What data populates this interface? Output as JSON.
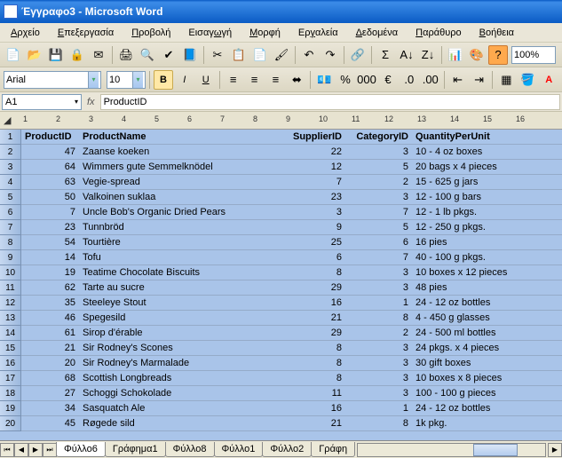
{
  "window": {
    "title": "Έγγραφο3 - Microsoft Word"
  },
  "menu": {
    "items": [
      {
        "label": "Αρχείο",
        "u": 0
      },
      {
        "label": "Επεξεργασία",
        "u": 0
      },
      {
        "label": "Προβολή",
        "u": 0
      },
      {
        "label": "Εισαγωγή",
        "u": 5
      },
      {
        "label": "Μορφή",
        "u": 0
      },
      {
        "label": "Εργαλεία",
        "u": 2
      },
      {
        "label": "Δεδομένα",
        "u": 0
      },
      {
        "label": "Παράθυρο",
        "u": 0
      },
      {
        "label": "Βοήθεια",
        "u": 0
      }
    ]
  },
  "toolbar1": {
    "zoom": "100%"
  },
  "toolbar2": {
    "font": "Arial",
    "size": "10"
  },
  "namebox": {
    "cell": "A1",
    "formula": "ProductID",
    "fx": "fx"
  },
  "ruler": {
    "marks": [
      "1",
      "2",
      "3",
      "4",
      "5",
      "6",
      "7",
      "8",
      "9",
      "10",
      "11",
      "12",
      "13",
      "14",
      "15",
      "16"
    ]
  },
  "columns": [
    "ProductID",
    "ProductName",
    "SupplierID",
    "CategoryID",
    "QuantityPerUnit"
  ],
  "rows": [
    {
      "pid": "47",
      "name": "Zaanse koeken",
      "sid": "22",
      "cid": "3",
      "qpu": "10 - 4 oz boxes"
    },
    {
      "pid": "64",
      "name": "Wimmers gute Semmelknödel",
      "sid": "12",
      "cid": "5",
      "qpu": "20 bags x 4 pieces"
    },
    {
      "pid": "63",
      "name": "Vegie-spread",
      "sid": "7",
      "cid": "2",
      "qpu": "15 - 625 g jars"
    },
    {
      "pid": "50",
      "name": "Valkoinen suklaa",
      "sid": "23",
      "cid": "3",
      "qpu": "12 - 100 g bars"
    },
    {
      "pid": "7",
      "name": "Uncle Bob's Organic Dried Pears",
      "sid": "3",
      "cid": "7",
      "qpu": "12 - 1 lb pkgs."
    },
    {
      "pid": "23",
      "name": "Tunnbröd",
      "sid": "9",
      "cid": "5",
      "qpu": "12 - 250 g pkgs."
    },
    {
      "pid": "54",
      "name": "Tourtière",
      "sid": "25",
      "cid": "6",
      "qpu": "16 pies"
    },
    {
      "pid": "14",
      "name": "Tofu",
      "sid": "6",
      "cid": "7",
      "qpu": "40 - 100 g pkgs."
    },
    {
      "pid": "19",
      "name": "Teatime Chocolate Biscuits",
      "sid": "8",
      "cid": "3",
      "qpu": "10 boxes x 12 pieces"
    },
    {
      "pid": "62",
      "name": "Tarte au sucre",
      "sid": "29",
      "cid": "3",
      "qpu": "48 pies"
    },
    {
      "pid": "35",
      "name": "Steeleye Stout",
      "sid": "16",
      "cid": "1",
      "qpu": "24 - 12 oz bottles"
    },
    {
      "pid": "46",
      "name": "Spegesild",
      "sid": "21",
      "cid": "8",
      "qpu": "4 - 450 g glasses"
    },
    {
      "pid": "61",
      "name": "Sirop d'érable",
      "sid": "29",
      "cid": "2",
      "qpu": "24 - 500 ml bottles"
    },
    {
      "pid": "21",
      "name": "Sir Rodney's Scones",
      "sid": "8",
      "cid": "3",
      "qpu": "24 pkgs. x 4 pieces"
    },
    {
      "pid": "20",
      "name": "Sir Rodney's Marmalade",
      "sid": "8",
      "cid": "3",
      "qpu": "30 gift boxes"
    },
    {
      "pid": "68",
      "name": "Scottish Longbreads",
      "sid": "8",
      "cid": "3",
      "qpu": "10 boxes x 8 pieces"
    },
    {
      "pid": "27",
      "name": "Schoggi Schokolade",
      "sid": "11",
      "cid": "3",
      "qpu": "100 - 100 g pieces"
    },
    {
      "pid": "34",
      "name": "Sasquatch Ale",
      "sid": "16",
      "cid": "1",
      "qpu": "24 - 12 oz bottles"
    },
    {
      "pid": "45",
      "name": "Røgede sild",
      "sid": "21",
      "cid": "8",
      "qpu": "1k pkg."
    }
  ],
  "sheets": {
    "tabs": [
      "Φύλλο6",
      "Γράφημα1",
      "Φύλλο8",
      "Φύλλο1",
      "Φύλλο2",
      "Γράφη"
    ],
    "active": 0
  }
}
